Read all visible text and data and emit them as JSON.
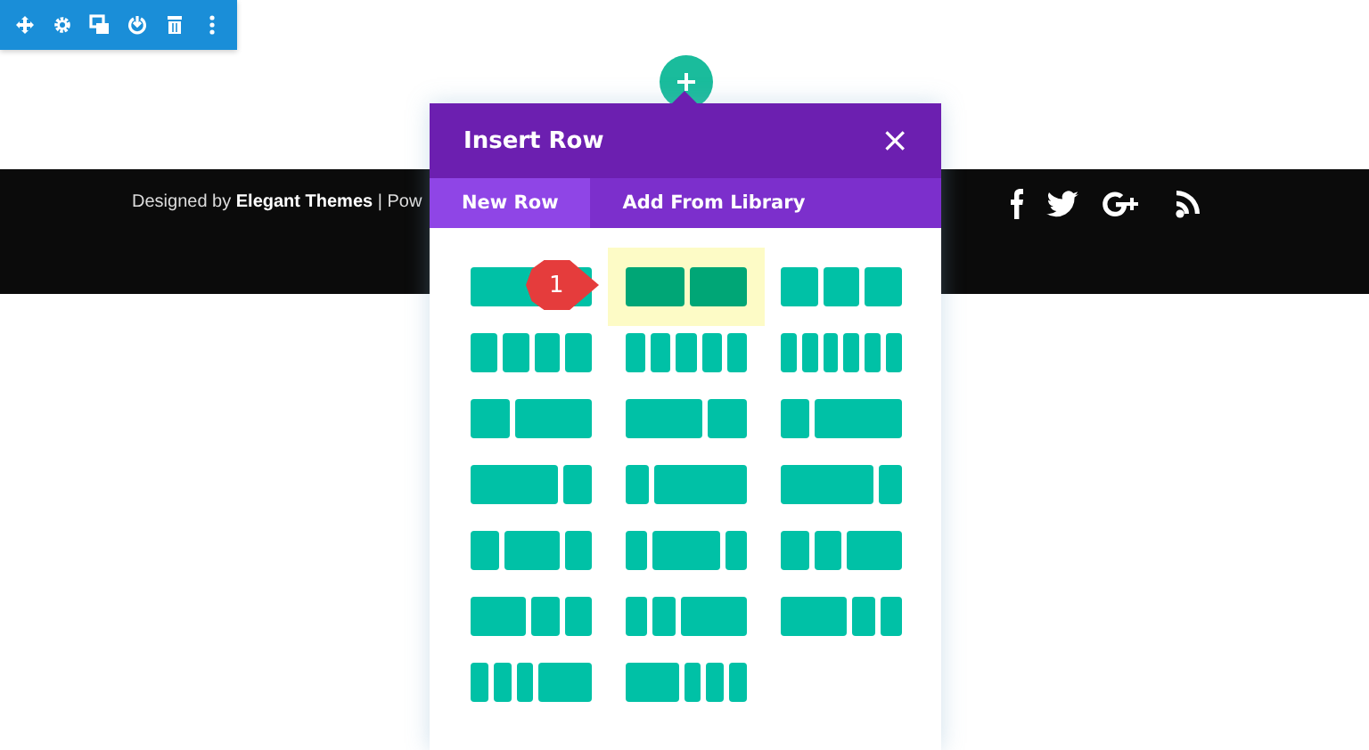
{
  "footer": {
    "credit": "Designed by **Elegant Themes** | Pow"
  },
  "insert_row": {
    "title": "Insert Row",
    "close": "×",
    "tabs": [
      {
        "label": "New Row",
        "selected": true
      },
      {
        "label": "Add From Library",
        "selected": false
      }
    ],
    "layouts": [
      {
        "kind": "full",
        "selected": false
      },
      {
        "kind": "halves",
        "selected": true
      },
      {
        "kind": "thirds",
        "selected": false
      },
      {
        "kind": "quarters",
        "selected": false
      },
      {
        "kind": "fifths",
        "selected": false
      },
      {
        "kind": "sixths",
        "selected": false
      },
      {
        "kind": "narrowwide",
        "selected": false
      },
      {
        "kind": "widenarrow",
        "selected": false
      },
      {
        "kind": "quarterwide",
        "selected": false
      },
      {
        "kind": "widequarter",
        "selected": false
      },
      {
        "kind": "fifthwide",
        "selected": false
      },
      {
        "kind": "widefifth",
        "selected": false
      },
      {
        "kind": "centerwide",
        "selected": false
      },
      {
        "kind": "centerwider",
        "selected": false
      },
      {
        "kind": "rightwide",
        "selected": false
      },
      {
        "kind": "leftwide",
        "selected": false
      },
      {
        "kind": "rightwider",
        "selected": false
      },
      {
        "kind": "leftwider",
        "selected": false
      },
      {
        "kind": "rightwidest",
        "selected": false
      },
      {
        "kind": "leftwidest",
        "selected": false
      }
    ],
    "callout": "1"
  }
}
